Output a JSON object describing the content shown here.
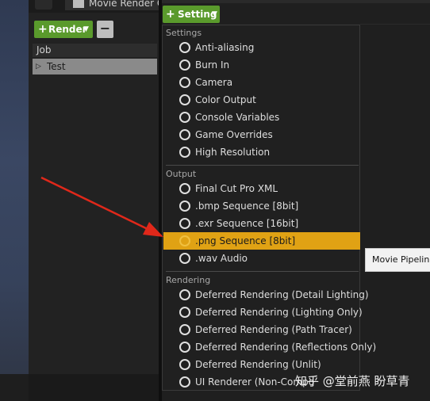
{
  "tab": {
    "title": "Movie Render Q"
  },
  "job_panel": {
    "render_button": "Render",
    "job_header": "Job",
    "jobs": [
      "Test"
    ]
  },
  "settings_panel": {
    "setting_button": "Setting"
  },
  "menu": {
    "sections": [
      {
        "title": "Settings",
        "items": [
          "Anti-aliasing",
          "Burn In",
          "Camera",
          "Color Output",
          "Console Variables",
          "Game Overrides",
          "High Resolution"
        ]
      },
      {
        "title": "Output",
        "items": [
          "Final Cut Pro XML",
          ".bmp Sequence [8bit]",
          ".exr Sequence [16bit]",
          ".png Sequence [8bit]",
          ".wav Audio"
        ]
      },
      {
        "title": "Rendering",
        "items": [
          "Deferred Rendering (Detail Lighting)",
          "Deferred Rendering (Lighting Only)",
          "Deferred Rendering (Path Tracer)",
          "Deferred Rendering (Reflections Only)",
          "Deferred Rendering (Unlit)",
          "UI Renderer (Non-Compo"
        ]
      }
    ],
    "highlighted": ".png Sequence [8bit]"
  },
  "tooltip": {
    "text": "Movie Pipeline"
  },
  "watermark": {
    "text": "知乎 @堂前燕 盼草青"
  },
  "colors": {
    "accent_green": "#5a9a2c",
    "highlight": "#e0a214",
    "arrow": "#e0281a"
  }
}
